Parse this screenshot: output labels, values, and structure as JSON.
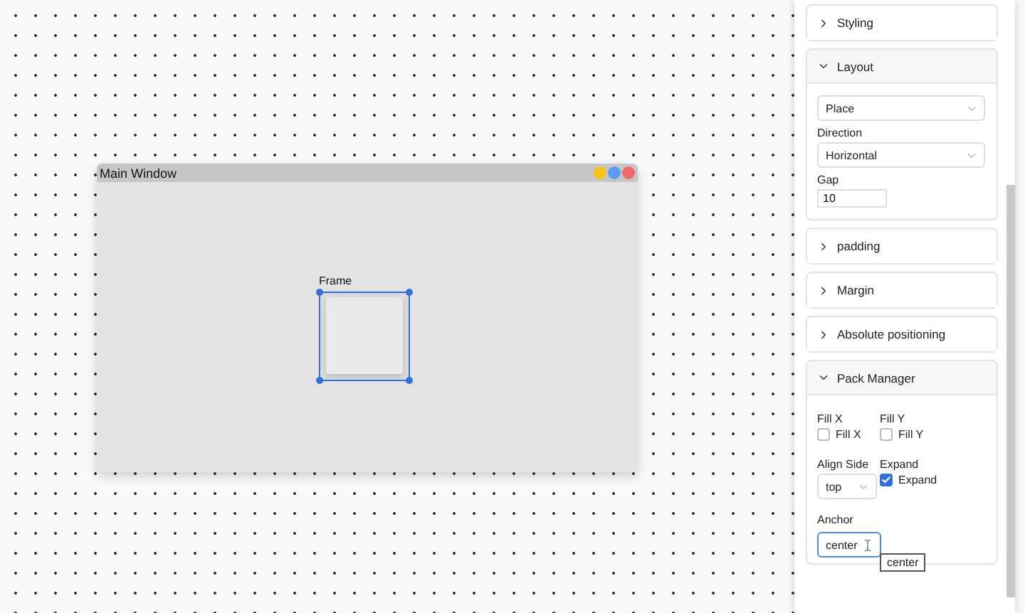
{
  "window": {
    "title": "Main Window",
    "controls": [
      {
        "color": "#f5c518"
      },
      {
        "color": "#5b9cf5"
      },
      {
        "color": "#f06a6a"
      }
    ]
  },
  "frame": {
    "label": "Frame",
    "selected": true
  },
  "panel": {
    "sections": [
      {
        "title": "Styling",
        "expanded": false
      },
      {
        "kind": "layout",
        "title": "Layout",
        "expanded": true,
        "manager": "Place",
        "direction_label": "Direction",
        "direction": "Horizontal",
        "gap_label": "Gap",
        "gap": "10"
      },
      {
        "title": "padding",
        "expanded": false
      },
      {
        "title": "Margin",
        "expanded": false
      },
      {
        "title": "Absolute positioning",
        "expanded": false
      },
      {
        "kind": "pack",
        "title": "Pack Manager",
        "expanded": true,
        "fill_x_label": "Fill X",
        "fill_x": {
          "label": "Fill X",
          "checked": false
        },
        "fill_y_label": "Fill Y",
        "fill_y": {
          "label": "Fill Y",
          "checked": false
        },
        "side_label": "Align Side",
        "side": "top",
        "expand_label": "Expand",
        "expand": {
          "label": "Expand",
          "checked": true
        },
        "anchor_label": "Anchor",
        "anchor": "center",
        "tooltip": "center"
      }
    ]
  }
}
